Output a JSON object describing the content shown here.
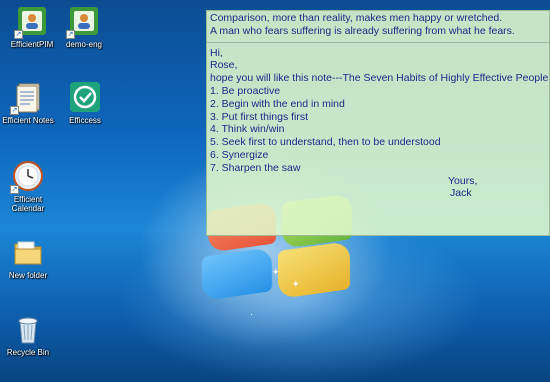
{
  "desktop": {
    "icons": [
      {
        "label": "EfficientPIM",
        "icon": "efficientpim-icon"
      },
      {
        "label": "demo-eng",
        "icon": "demo-eng-icon"
      },
      {
        "label": "Efficient Notes",
        "icon": "efficient-notes-icon"
      },
      {
        "label": "Efficcess",
        "icon": "efficcess-icon"
      },
      {
        "label": "Efficient Calendar",
        "icon": "efficient-calendar-icon"
      },
      {
        "label": "New folder",
        "icon": "folder-icon"
      },
      {
        "label": "Recycle Bin",
        "icon": "recycle-bin-icon"
      }
    ]
  },
  "note": {
    "quotes": [
      "Comparison, more than reality, makes men happy or wretched.",
      "A man who fears suffering is already suffering from what he fears."
    ],
    "body": [
      "Hi,",
      "Rose,",
      "hope you will like this note---The Seven Habits of Highly Effective People",
      "1. Be proactive",
      "2. Begin with the end in mind",
      "3. Put first things first",
      "4. Think win/win",
      "5. Seek first to understand, then to be understood",
      "6. Synergize",
      "7. Sharpen the saw"
    ],
    "signature": [
      "Yours,",
      "Jack"
    ],
    "colors": {
      "background": "#e0f8cc",
      "text": "#1d2a86"
    }
  }
}
